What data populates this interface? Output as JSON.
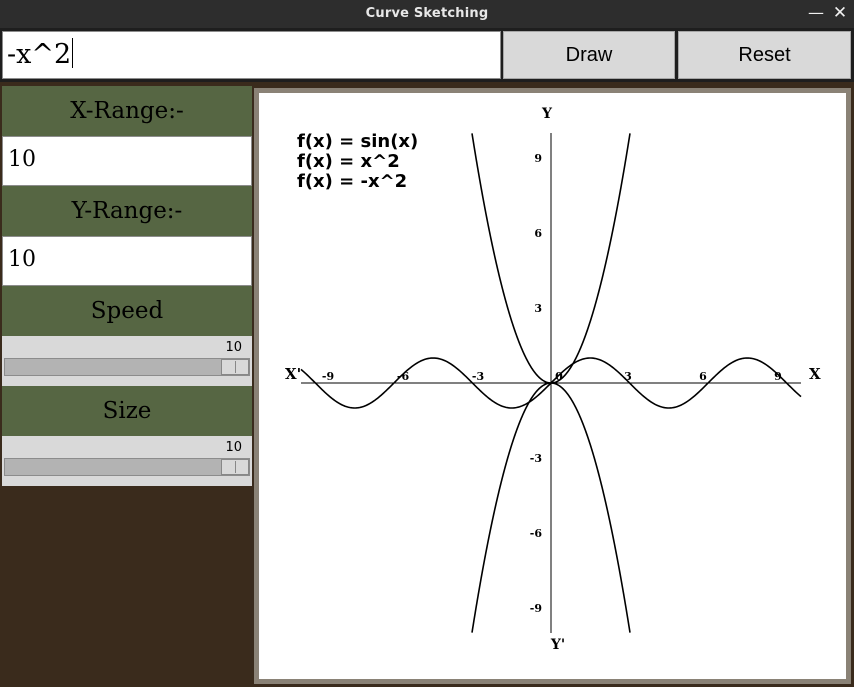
{
  "window": {
    "title": "Curve Sketching",
    "minimize_glyph": "—",
    "close_glyph": "✕"
  },
  "toolbar": {
    "expression_value": "-x^2",
    "draw_label": "Draw",
    "reset_label": "Reset"
  },
  "panel": {
    "x_range_label": "X-Range:-",
    "x_range_value": "10",
    "y_range_label": "Y-Range:-",
    "y_range_value": "10",
    "speed_label": "Speed",
    "speed_value": "10",
    "size_label": "Size",
    "size_value": "10"
  },
  "colors": {
    "panel_label_bg": "#566643",
    "panel_bg": "#3a2b1c",
    "canvas_bg": "#ffffff",
    "curve": "#000000"
  },
  "chart_data": {
    "type": "line",
    "xlim": [
      -10,
      10
    ],
    "ylim": [
      -10,
      10
    ],
    "x_axis_label": "X",
    "x_axis_neg_label": "X'",
    "y_axis_label": "Y",
    "y_axis_neg_label": "Y'",
    "x_ticks": [
      -9,
      -6,
      -3,
      0,
      3,
      6,
      9
    ],
    "x_tick_labels": [
      "-9",
      "-6",
      "-3",
      "0",
      "3",
      "6",
      "9"
    ],
    "y_ticks": [
      9,
      6,
      3,
      -3,
      -6,
      -9
    ],
    "y_tick_labels": [
      "9",
      "6",
      "3",
      "-3",
      "-6",
      "-9"
    ],
    "legend": [
      "f(x) = sin(x)",
      "f(x) = x^2",
      "f(x) = -x^2"
    ],
    "series": [
      {
        "name": "f(x) = sin(x)",
        "expr": "sin",
        "x_range": [
          -10,
          10
        ]
      },
      {
        "name": "f(x) = x^2",
        "expr": "square",
        "x_range": [
          -3.16,
          3.16
        ]
      },
      {
        "name": "f(x) = -x^2",
        "expr": "neg_square",
        "x_range": [
          -3.16,
          3.16
        ]
      }
    ]
  }
}
